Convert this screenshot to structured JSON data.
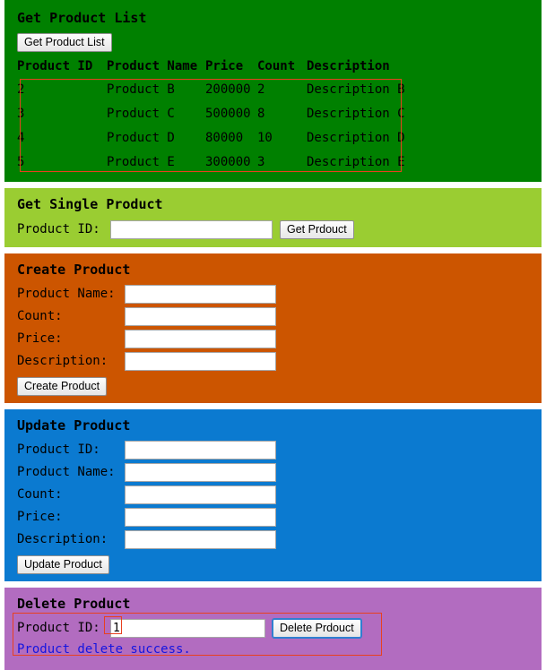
{
  "sections": {
    "list": {
      "title": "Get Product List",
      "button_label": "Get Product List",
      "table": {
        "headers": [
          "Product ID",
          "Product Name",
          "Price",
          "Count",
          "Description"
        ],
        "rows": [
          [
            "2",
            "Product B",
            "200000",
            "2",
            "Description B"
          ],
          [
            "3",
            "Product C",
            "500000",
            "8",
            "Description C"
          ],
          [
            "4",
            "Product D",
            "80000",
            "10",
            "Description D"
          ],
          [
            "5",
            "Product E",
            "300000",
            "3",
            "Description E"
          ]
        ]
      }
    },
    "single": {
      "title": "Get Single Product",
      "id_label": "Product ID:",
      "id_value": "",
      "button_label": "Get Prdouct"
    },
    "create": {
      "title": "Create Product",
      "name_label": "Product Name:",
      "name_value": "",
      "count_label": "Count:",
      "count_value": "",
      "price_label": "Price:",
      "price_value": "",
      "description_label": "Description:",
      "description_value": "",
      "button_label": "Create Product"
    },
    "update": {
      "title": "Update Product",
      "id_label": "Product ID:",
      "id_value": "",
      "name_label": "Product Name:",
      "name_value": "",
      "count_label": "Count:",
      "count_value": "",
      "price_label": "Price:",
      "price_value": "",
      "description_label": "Description:",
      "description_value": "",
      "button_label": "Update Product"
    },
    "delete": {
      "title": "Delete Product",
      "id_label": "Product ID:",
      "id_value": "1",
      "button_label": "Delete Prdouct",
      "status_message": "Product delete success."
    }
  },
  "colors": {
    "list_bg": "#008000",
    "single_bg": "#9ACD32",
    "create_bg": "#CC5500",
    "update_bg": "#0B7AD0",
    "delete_bg": "#B26CC0",
    "annotation": "#E8401F",
    "highlight": "#2F7FD0",
    "status_text": "#1515E0"
  }
}
